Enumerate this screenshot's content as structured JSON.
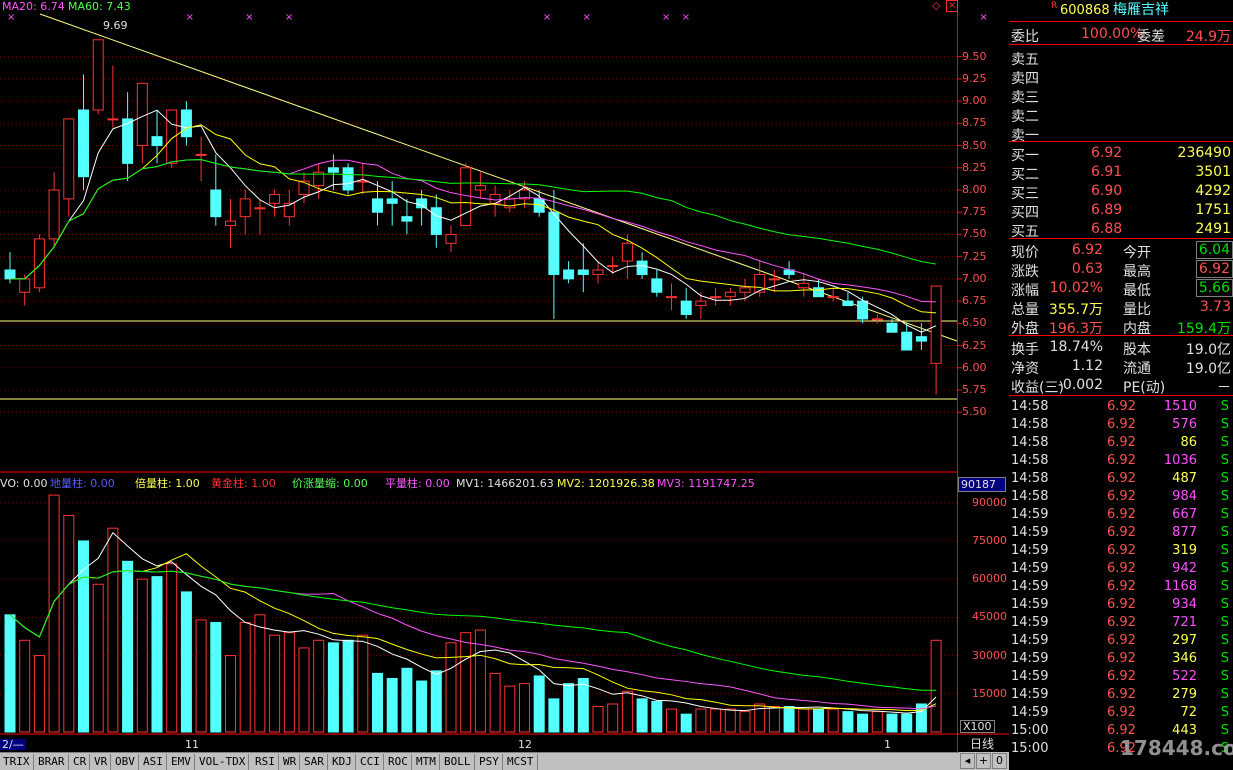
{
  "colors": {
    "up": "#ff3232",
    "down": "#54ffff",
    "ma5": "#ffffff",
    "ma10": "#ffff00",
    "ma20": "#ff54ff",
    "ma60": "#00ff00",
    "grid": "#800000",
    "axis": "#ff0000",
    "trend": "#ffff80"
  },
  "top_legend": {
    "ma20": "MA20: 6.74",
    "ma60": "MA60: 7.43",
    "high_label": "9.69"
  },
  "price_axis": [
    "9.50",
    "9.25",
    "9.00",
    "8.75",
    "8.50",
    "8.25",
    "8.00",
    "7.75",
    "7.50",
    "7.25",
    "7.00",
    "6.75",
    "6.50",
    "6.25",
    "6.00",
    "5.75",
    "5.50"
  ],
  "vol_legend": {
    "vo": "VO: 0.00",
    "lb": "地量柱: 0.00",
    "bl": "倍量柱: 1.00",
    "hj": "黄金柱: 1.00",
    "jz": "价涨量缩: 0.00",
    "pl": "平量柱: 0.00",
    "mv1": "MV1: 1466201.63",
    "mv2": "MV2: 1201926.38",
    "mv3": "MV3: 1191747.25"
  },
  "vol_axis_top": "90187",
  "vol_axis": [
    "90000",
    "75000",
    "60000",
    "45000",
    "30000",
    "15000"
  ],
  "vol_unit": "X100",
  "date_labels": [
    "2/—",
    "11",
    "12",
    "1"
  ],
  "period": "日线",
  "watermark": "178448.com",
  "chart_data": {
    "type": "candlestick",
    "price_ylim": [
      5.3,
      9.8
    ],
    "volume_ylim": [
      0,
      95000
    ],
    "candles": [
      [
        7.1,
        7.3,
        6.95,
        7.0,
        46000
      ],
      [
        6.85,
        7.05,
        6.7,
        7.0,
        36000
      ],
      [
        6.9,
        7.5,
        6.85,
        7.45,
        30000
      ],
      [
        7.45,
        8.2,
        7.35,
        8.0,
        93000
      ],
      [
        7.9,
        8.8,
        7.7,
        8.8,
        85000
      ],
      [
        8.9,
        9.3,
        8.0,
        8.15,
        75000
      ],
      [
        8.9,
        9.69,
        8.85,
        9.69,
        58000
      ],
      [
        8.8,
        9.4,
        8.7,
        8.8,
        80000
      ],
      [
        8.8,
        9.1,
        8.1,
        8.3,
        67000
      ],
      [
        8.5,
        9.2,
        8.3,
        9.2,
        60000
      ],
      [
        8.6,
        8.9,
        8.3,
        8.5,
        61000
      ],
      [
        8.3,
        8.9,
        8.25,
        8.9,
        66000
      ],
      [
        8.9,
        9.0,
        8.5,
        8.6,
        55000
      ],
      [
        8.4,
        8.6,
        8.1,
        8.4,
        44000
      ],
      [
        8.0,
        8.4,
        7.6,
        7.7,
        43000
      ],
      [
        7.6,
        7.9,
        7.35,
        7.65,
        30000
      ],
      [
        7.7,
        8.0,
        7.5,
        7.9,
        43000
      ],
      [
        7.8,
        7.9,
        7.5,
        7.8,
        46000
      ],
      [
        7.85,
        8.0,
        7.7,
        7.95,
        38000
      ],
      [
        7.7,
        8.0,
        7.6,
        7.85,
        39000
      ],
      [
        7.95,
        8.2,
        7.85,
        8.1,
        33000
      ],
      [
        8.05,
        8.3,
        7.9,
        8.2,
        36000
      ],
      [
        8.25,
        8.4,
        8.0,
        8.2,
        35000
      ],
      [
        8.25,
        8.3,
        7.95,
        8.0,
        36000
      ],
      [
        8.1,
        8.3,
        7.95,
        8.1,
        38000
      ],
      [
        7.9,
        8.1,
        7.6,
        7.75,
        23000
      ],
      [
        7.9,
        8.1,
        7.6,
        7.85,
        21000
      ],
      [
        7.7,
        7.9,
        7.5,
        7.65,
        25000
      ],
      [
        7.9,
        8.0,
        7.6,
        7.8,
        20000
      ],
      [
        7.8,
        7.95,
        7.35,
        7.5,
        24000
      ],
      [
        7.4,
        7.6,
        7.3,
        7.5,
        35000
      ],
      [
        7.6,
        8.3,
        7.6,
        8.25,
        39000
      ],
      [
        8.0,
        8.2,
        7.9,
        8.05,
        40000
      ],
      [
        7.85,
        8.05,
        7.7,
        7.95,
        23000
      ],
      [
        7.8,
        8.0,
        7.75,
        7.9,
        18000
      ],
      [
        7.9,
        8.1,
        7.8,
        8.0,
        19000
      ],
      [
        7.9,
        8.0,
        7.7,
        7.75,
        22000
      ],
      [
        7.75,
        8.0,
        6.55,
        7.05,
        13000
      ],
      [
        7.1,
        7.2,
        6.95,
        7.0,
        19000
      ],
      [
        7.1,
        7.4,
        6.85,
        7.05,
        21000
      ],
      [
        7.05,
        7.2,
        6.95,
        7.1,
        10000
      ],
      [
        7.15,
        7.25,
        7.05,
        7.15,
        11000
      ],
      [
        7.2,
        7.5,
        7.0,
        7.4,
        16000
      ],
      [
        7.2,
        7.3,
        7.0,
        7.05,
        13000
      ],
      [
        7.0,
        7.1,
        6.8,
        6.85,
        12000
      ],
      [
        6.8,
        6.95,
        6.65,
        6.8,
        9000
      ],
      [
        6.75,
        6.9,
        6.55,
        6.6,
        7000
      ],
      [
        6.7,
        6.85,
        6.55,
        6.75,
        9000
      ],
      [
        6.8,
        6.9,
        6.7,
        6.8,
        9000
      ],
      [
        6.8,
        6.9,
        6.7,
        6.85,
        9000
      ],
      [
        6.85,
        7.0,
        6.75,
        6.9,
        8000
      ],
      [
        6.85,
        7.2,
        6.8,
        7.05,
        11000
      ],
      [
        7.0,
        7.1,
        6.85,
        7.0,
        10000
      ],
      [
        7.1,
        7.2,
        7.0,
        7.05,
        10000
      ],
      [
        6.9,
        7.05,
        6.8,
        6.95,
        9000
      ],
      [
        6.9,
        7.0,
        6.8,
        6.8,
        9000
      ],
      [
        6.8,
        6.9,
        6.75,
        6.8,
        9000
      ],
      [
        6.75,
        6.85,
        6.7,
        6.7,
        8000
      ],
      [
        6.75,
        6.8,
        6.5,
        6.55,
        7000
      ],
      [
        6.55,
        6.6,
        6.5,
        6.55,
        8000
      ],
      [
        6.5,
        6.55,
        6.4,
        6.4,
        7000
      ],
      [
        6.4,
        6.5,
        6.2,
        6.2,
        7000
      ],
      [
        6.35,
        6.5,
        6.2,
        6.3,
        11000
      ],
      [
        6.05,
        6.92,
        5.7,
        6.92,
        36000
      ]
    ]
  },
  "quote": {
    "code": "600868",
    "name": "梅雁吉祥",
    "wb_label": "委比",
    "wb_value": "100.00%",
    "wc_label": "委差",
    "wc_value": "24.9万",
    "asks": [
      {
        "label": "卖五",
        "price": "",
        "vol": ""
      },
      {
        "label": "卖四",
        "price": "",
        "vol": ""
      },
      {
        "label": "卖三",
        "price": "",
        "vol": ""
      },
      {
        "label": "卖二",
        "price": "",
        "vol": ""
      },
      {
        "label": "卖一",
        "price": "",
        "vol": ""
      }
    ],
    "bids": [
      {
        "label": "买一",
        "price": "6.92",
        "vol": "236490"
      },
      {
        "label": "买二",
        "price": "6.91",
        "vol": "3501"
      },
      {
        "label": "买三",
        "price": "6.90",
        "vol": "4292"
      },
      {
        "label": "买四",
        "price": "6.89",
        "vol": "1751"
      },
      {
        "label": "买五",
        "price": "6.88",
        "vol": "2491"
      }
    ],
    "stats": [
      {
        "l1": "现价",
        "v1": "6.92",
        "c1": "red",
        "l2": "今开",
        "v2": "6.04",
        "c2": "grn-box"
      },
      {
        "l1": "涨跌",
        "v1": "0.63",
        "c1": "red",
        "l2": "最高",
        "v2": "6.92",
        "c2": "red-box"
      },
      {
        "l1": "涨幅",
        "v1": "10.02%",
        "c1": "red",
        "l2": "最低",
        "v2": "5.66",
        "c2": "grn-box"
      },
      {
        "l1": "总量",
        "v1": "355.7万",
        "c1": "ylw",
        "l2": "量比",
        "v2": "3.73",
        "c2": "red"
      },
      {
        "l1": "外盘",
        "v1": "196.3万",
        "c1": "red",
        "l2": "内盘",
        "v2": "159.4万",
        "c2": "grn"
      },
      {
        "l1": "换手",
        "v1": "18.74%",
        "c1": "wht",
        "l2": "股本",
        "v2": "19.0亿",
        "c2": "wht"
      },
      {
        "l1": "净资",
        "v1": "1.12",
        "c1": "wht",
        "l2": "流通",
        "v2": "19.0亿",
        "c2": "wht"
      },
      {
        "l1": "收益(三)",
        "v1": "-0.002",
        "c1": "wht",
        "l2": "PE(动)",
        "v2": "－",
        "c2": "wht"
      }
    ],
    "ticks": [
      {
        "t": "14:58",
        "p": "6.92",
        "v": "1510",
        "s": "S",
        "vc": "mag"
      },
      {
        "t": "14:58",
        "p": "6.92",
        "v": "576",
        "s": "S",
        "vc": "mag"
      },
      {
        "t": "14:58",
        "p": "6.92",
        "v": "86",
        "s": "S",
        "vc": "ylw"
      },
      {
        "t": "14:58",
        "p": "6.92",
        "v": "1036",
        "s": "S",
        "vc": "mag"
      },
      {
        "t": "14:58",
        "p": "6.92",
        "v": "487",
        "s": "S",
        "vc": "ylw"
      },
      {
        "t": "14:58",
        "p": "6.92",
        "v": "984",
        "s": "S",
        "vc": "mag"
      },
      {
        "t": "14:59",
        "p": "6.92",
        "v": "667",
        "s": "S",
        "vc": "mag"
      },
      {
        "t": "14:59",
        "p": "6.92",
        "v": "877",
        "s": "S",
        "vc": "mag"
      },
      {
        "t": "14:59",
        "p": "6.92",
        "v": "319",
        "s": "S",
        "vc": "ylw"
      },
      {
        "t": "14:59",
        "p": "6.92",
        "v": "942",
        "s": "S",
        "vc": "mag"
      },
      {
        "t": "14:59",
        "p": "6.92",
        "v": "1168",
        "s": "S",
        "vc": "mag"
      },
      {
        "t": "14:59",
        "p": "6.92",
        "v": "934",
        "s": "S",
        "vc": "mag"
      },
      {
        "t": "14:59",
        "p": "6.92",
        "v": "721",
        "s": "S",
        "vc": "mag"
      },
      {
        "t": "14:59",
        "p": "6.92",
        "v": "297",
        "s": "S",
        "vc": "ylw"
      },
      {
        "t": "14:59",
        "p": "6.92",
        "v": "346",
        "s": "S",
        "vc": "ylw"
      },
      {
        "t": "14:59",
        "p": "6.92",
        "v": "522",
        "s": "S",
        "vc": "mag"
      },
      {
        "t": "14:59",
        "p": "6.92",
        "v": "279",
        "s": "S",
        "vc": "ylw"
      },
      {
        "t": "14:59",
        "p": "6.92",
        "v": "72",
        "s": "S",
        "vc": "ylw"
      },
      {
        "t": "15:00",
        "p": "6.92",
        "v": "443",
        "s": "S",
        "vc": "ylw"
      },
      {
        "t": "15:00",
        "p": "6.92",
        "v": "",
        "s": "S",
        "vc": "ylw"
      }
    ]
  },
  "tabs": [
    "TRIX",
    "BRAR",
    "CR",
    "VR",
    "OBV",
    "ASI",
    "EMV",
    "VOL-TDX",
    "RSI",
    "WR",
    "SAR",
    "KDJ",
    "CCI",
    "ROC",
    "MTM",
    "BOLL",
    "PSY",
    "MCST"
  ]
}
